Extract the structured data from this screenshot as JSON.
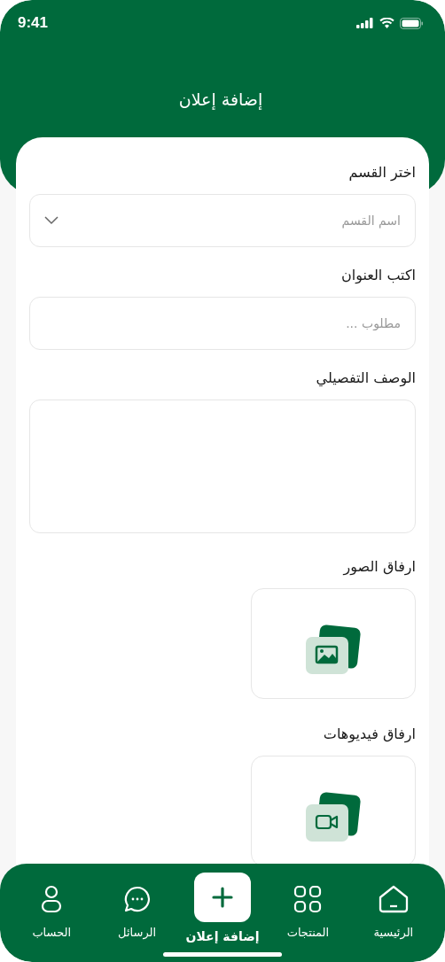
{
  "status_bar": {
    "time": "9:41"
  },
  "header": {
    "title": "إضافة إعلان"
  },
  "form": {
    "fields": [
      {
        "kind": "select",
        "label": "اختر القسم",
        "placeholder": "اسم القسم"
      },
      {
        "kind": "text",
        "label": "اكتب العنوان",
        "placeholder": "مطلوب ..."
      },
      {
        "kind": "textarea",
        "label": "الوصف التفصيلي"
      }
    ],
    "uploads": [
      {
        "kind": "image",
        "label": "ارفاق الصور"
      },
      {
        "kind": "video",
        "label": "ارفاق فيديوهات"
      }
    ]
  },
  "bottom_nav": [
    {
      "kind": "home",
      "label": "الرئيسية",
      "selected": false
    },
    {
      "kind": "products",
      "label": "المنتجات",
      "selected": false
    },
    {
      "kind": "add",
      "label": "إضافة إعلان",
      "selected": true
    },
    {
      "kind": "messages",
      "label": "الرسائل",
      "selected": false
    },
    {
      "kind": "account",
      "label": "الحساب",
      "selected": false
    }
  ]
}
